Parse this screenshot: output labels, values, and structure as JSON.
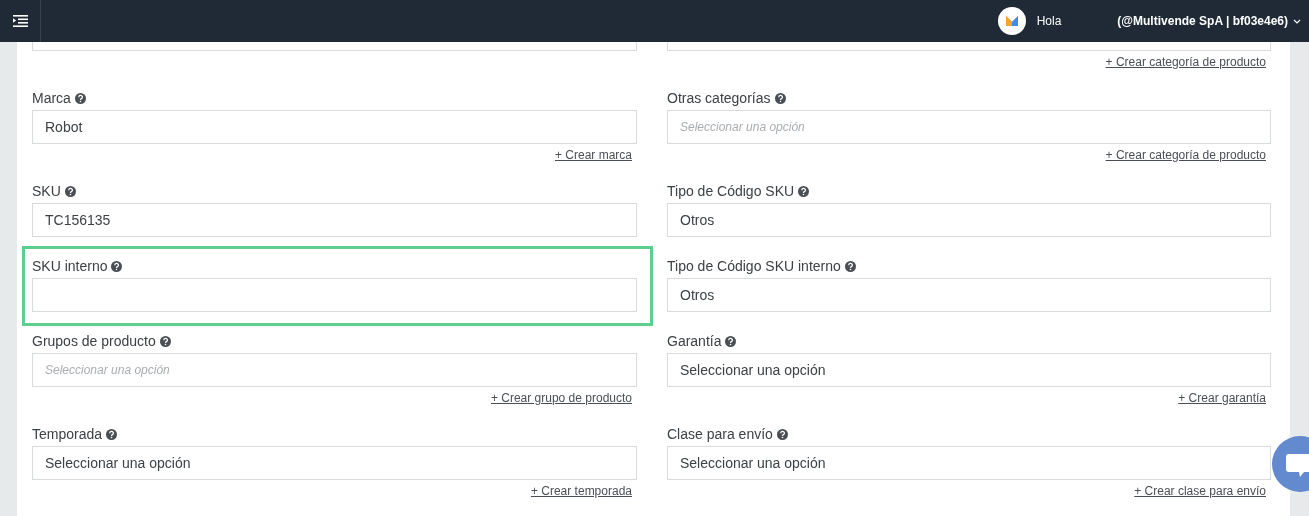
{
  "header": {
    "greeting": "Hola",
    "account": "(@Multivende SpA | bf03e4e6)"
  },
  "fields": [
    {
      "highlighted": false
    },
    {
      "highlighted": false,
      "link": "+ Crear categoría de producto"
    },
    {
      "label": "Marca",
      "value": "Robot",
      "link": "+ Crear marca",
      "highlighted": false
    },
    {
      "label": "Otras categorías",
      "placeholder": "Seleccionar una opción",
      "link": "+ Crear categoría de producto",
      "highlighted": false
    },
    {
      "label": "SKU",
      "value": "TC156135",
      "highlighted": false
    },
    {
      "label": "Tipo de Código SKU",
      "value": "Otros",
      "highlighted": false
    },
    {
      "label": "SKU interno",
      "highlighted": true
    },
    {
      "label": "Tipo de Código SKU interno",
      "value": "Otros",
      "highlighted": false
    },
    {
      "label": "Grupos de producto",
      "placeholder": "Seleccionar una opción",
      "link": "+ Crear grupo de producto",
      "highlighted": false
    },
    {
      "label": "Garantía",
      "value": "Seleccionar una opción",
      "link": "+ Crear garantía",
      "highlighted": false
    },
    {
      "label": "Temporada",
      "value": "Seleccionar una opción",
      "link": "+ Crear temporada",
      "highlighted": false
    },
    {
      "label": "Clase para envío",
      "value": "Seleccionar una opción",
      "link": "+ Crear clase para envío",
      "highlighted": false
    }
  ]
}
